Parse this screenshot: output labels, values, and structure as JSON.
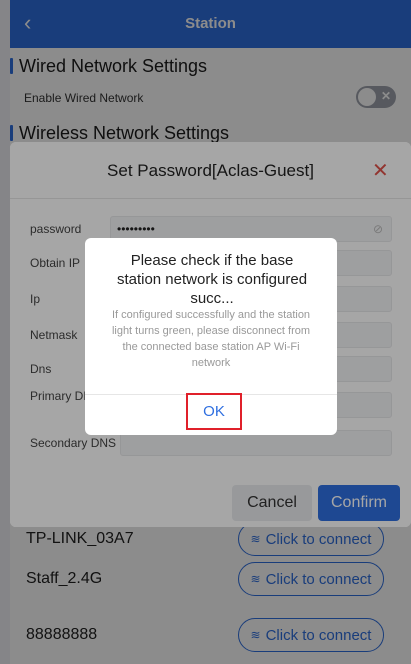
{
  "header": {
    "back_icon": "chevron-left-icon",
    "title": "Station"
  },
  "wired": {
    "heading": "Wired Network Settings",
    "enable_label": "Enable Wired Network",
    "toggle_state": "off"
  },
  "wireless": {
    "heading": "Wireless Network Settings"
  },
  "networks": [
    {
      "name": "TP-LINK_03A7",
      "button": "Click to connect"
    },
    {
      "name": "Staff_2.4G",
      "button": "Click to connect"
    },
    {
      "name": "88888888",
      "button": "Click to connect"
    }
  ],
  "password_dialog": {
    "title": "Set Password[Aclas-Guest]",
    "close_icon": "close-icon",
    "fields": [
      {
        "label": "password",
        "value": "•••••••••"
      },
      {
        "label": "Obtain IP",
        "value": ""
      },
      {
        "label": "Ip",
        "value": ""
      },
      {
        "label": "Netmask",
        "value": ""
      },
      {
        "label": "Dns",
        "value": ""
      },
      {
        "label": "Primary DNS",
        "value": ""
      },
      {
        "label": "Secondary DNS",
        "value": ""
      }
    ],
    "cancel_label": "Cancel",
    "confirm_label": "Confirm"
  },
  "alert": {
    "title": "Please check if the base station network is configured succ...",
    "message": "If configured successfully and the station light turns green, please disconnect from the connected base station AP Wi-Fi network",
    "ok_label": "OK"
  },
  "colors": {
    "primary": "#2f6fe0",
    "danger": "#e0524a",
    "highlight": "#e0202a"
  }
}
